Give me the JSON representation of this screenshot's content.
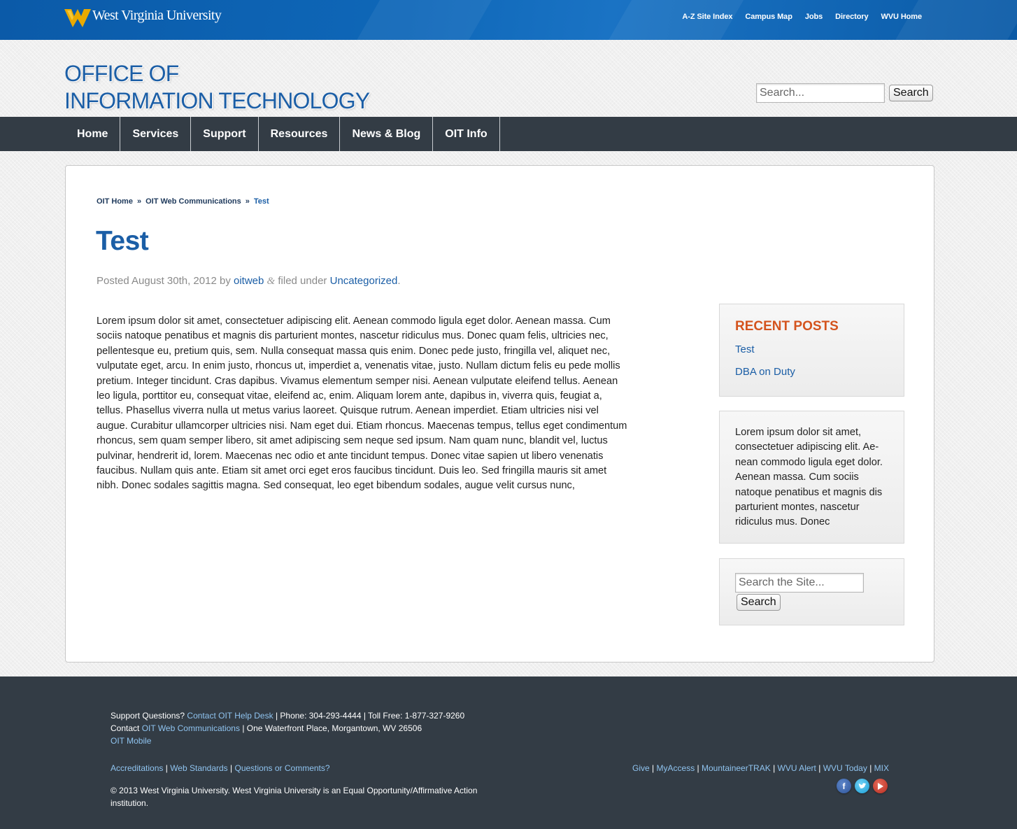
{
  "top_bar": {
    "university_name": "West Virginia University",
    "links": [
      "A-Z Site Index",
      "Campus Map",
      "Jobs",
      "Directory",
      "WVU Home"
    ]
  },
  "header": {
    "title_line1": "OFFICE OF",
    "title_line2": "INFORMATION TECHNOLOGY",
    "search_placeholder": "Search...",
    "search_button": "Search"
  },
  "nav": {
    "items": [
      "Home",
      "Services",
      "Support",
      "Resources",
      "News & Blog",
      "OIT Info"
    ]
  },
  "breadcrumb": {
    "items": [
      "OIT Home",
      "OIT Web Communications"
    ],
    "separator": "»",
    "current": "Test"
  },
  "post": {
    "title": "Test",
    "meta_prefix": "Posted August 30th, 2012 by",
    "author": "oitweb",
    "meta_middle": "filed under",
    "category": "Uncategorized",
    "body": "Lorem ipsum dolor sit amet, consectetuer adipiscing elit. Aenean commodo ligula eget dolor. Aenean massa. Cum sociis natoque penatibus et magnis dis parturient montes, nascetur ridiculus mus. Donec quam felis, ul­tricies nec, pellentesque eu, pretium quis, sem. Nulla consequat massa quis enim. Donec pede justo, fringilla vel, aliquet nec, vulputate eget, arcu. In enim justo, rhoncus ut, imperdiet a, venenatis vitae, justo. Nullam dic­tum felis eu pede mollis pretium. Integer tincidunt. Cras dapibus. Vivamus elementum semper nisi. Aenean vulputate eleifend tellus. Aenean leo ligula, porttitor eu, consequat vitae, eleifend ac, enim. Aliquam lorem ante, dapibus in, viverra quis, feugiat a, tellus. Phasellus viverra nulla ut metus varius laoreet. Quisque rutrum. Ae­nean imperdiet. Etiam ultricies nisi vel augue. Curabitur ullamcorper ultricies nisi. Nam eget dui. Etiam rhoncus. Maecenas tempus, tellus eget condimentum rhoncus, sem quam semper libero, sit amet adipiscing sem neque sed ipsum. Nam quam nunc, blandit vel, luctus pulvinar, hendrerit id, lorem. Maecenas nec odio et ante tincidunt tempus. Donec vitae sapien ut libero venenatis faucibus. Nullam quis ante. Etiam sit amet orci eget eros fau­cibus tincidunt. Duis leo. Sed fringilla mauris sit amet nibh. Donec sodales sagittis magna. Sed consequat, leo eget bibendum sodales, augue velit cursus nunc,"
  },
  "sidebar": {
    "recent_posts_title": "RECENT POSTS",
    "recent_posts": [
      "Test",
      "DBA on Duty"
    ],
    "text_widget": "Lorem ipsum dolor sit amet, consectetuer adipiscing elit. Ae­nean commodo ligula eget do­lor. Aenean massa. Cum sociis natoque penatibus et magnis dis parturient montes, nascetur ridiculus mus. Donec",
    "search_placeholder": "Search the Site...",
    "search_button": "Search"
  },
  "footer": {
    "support_label": "Support Questions?",
    "helpdesk_link": "Contact OIT Help Desk",
    "phone_text": "| Phone: 304-293-4444 | Toll Free: 1-877-327-9260",
    "contact_label": "Contact",
    "webcomm_link": "OIT Web Communications",
    "address_text": "| One Waterfront Place, Morgantown, WV 26506",
    "mobile_link": "OIT Mobile",
    "left_links": [
      "Accreditations",
      "Web Standards",
      "Questions or Comments?"
    ],
    "right_links": [
      "Give",
      "MyAccess",
      "MountaineerTRAK",
      "WVU Alert",
      "WVU Today",
      "MIX"
    ],
    "copyright": "© 2013 West Virginia University. West Virginia University is an Equal Opportunity/Affirmative Action institution.",
    "social_icons": [
      "facebook-icon",
      "twitter-icon",
      "youtube-icon"
    ]
  },
  "colors": {
    "brand_blue": "#1b5ea6",
    "top_bar_blue": "#0e67b8",
    "wvu_gold": "#eaaa00",
    "nav_dark": "#333c45",
    "recent_posts_orange": "#d4541e",
    "footer_link": "#8fc3ef"
  }
}
